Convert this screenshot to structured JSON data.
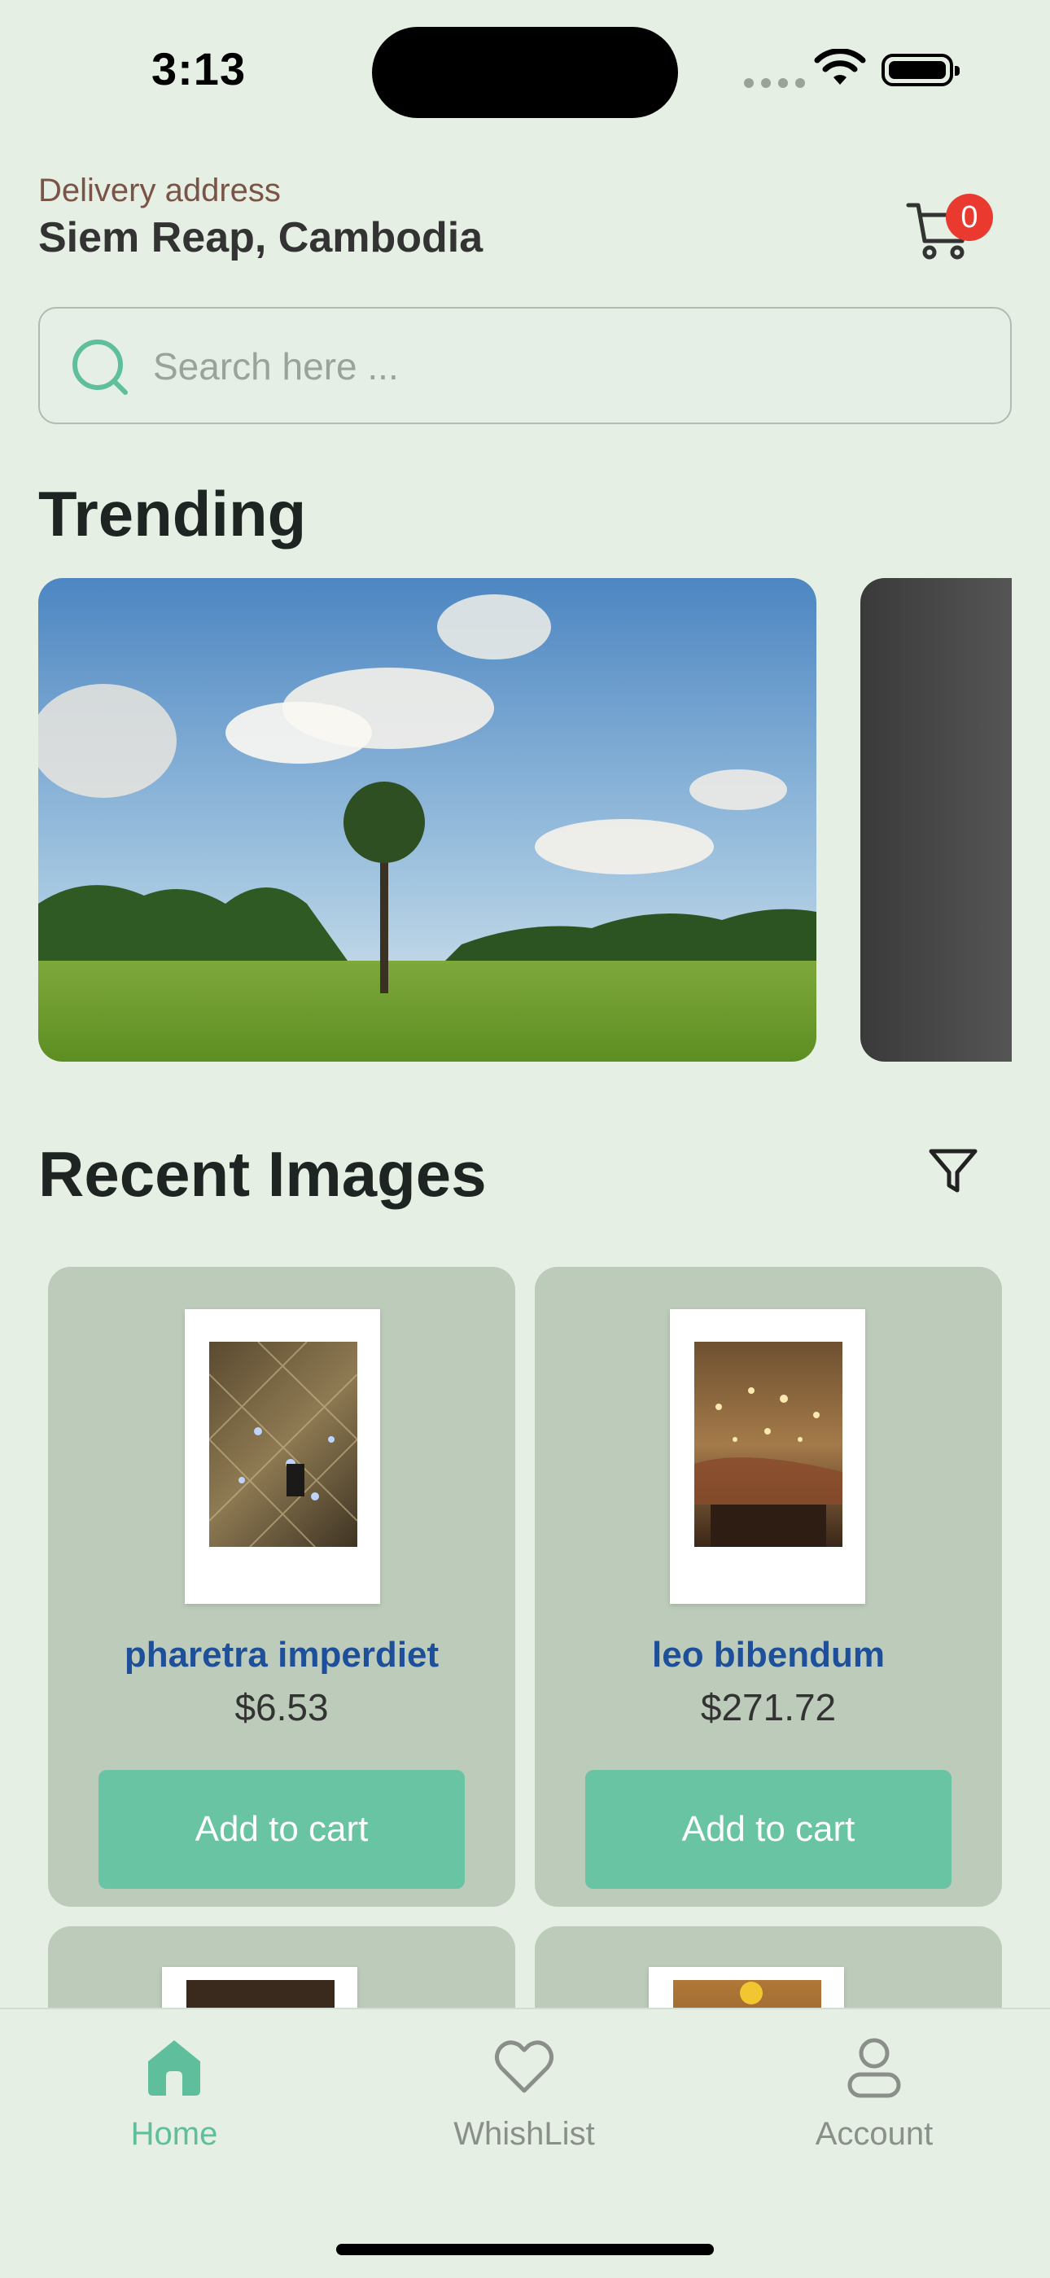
{
  "status_bar": {
    "time": "3:13"
  },
  "header": {
    "delivery_label": "Delivery address",
    "address": "Siem Reap, Cambodia",
    "cart_count": "0"
  },
  "search": {
    "placeholder": "Search here ..."
  },
  "trending": {
    "title": "Trending"
  },
  "recent": {
    "title": "Recent Images"
  },
  "products": [
    {
      "name": "pharetra imperdiet",
      "price": "$6.53",
      "button": "Add to cart"
    },
    {
      "name": "leo bibendum",
      "price": "$271.72",
      "button": "Add to cart"
    }
  ],
  "nav": {
    "home": "Home",
    "wishlist": "WhishList",
    "account": "Account"
  },
  "colors": {
    "background": "#e5efe4",
    "accent": "#69c4a3",
    "card": "#bdccba",
    "product_name": "#1e4f9a",
    "badge": "#ea3a2f"
  }
}
